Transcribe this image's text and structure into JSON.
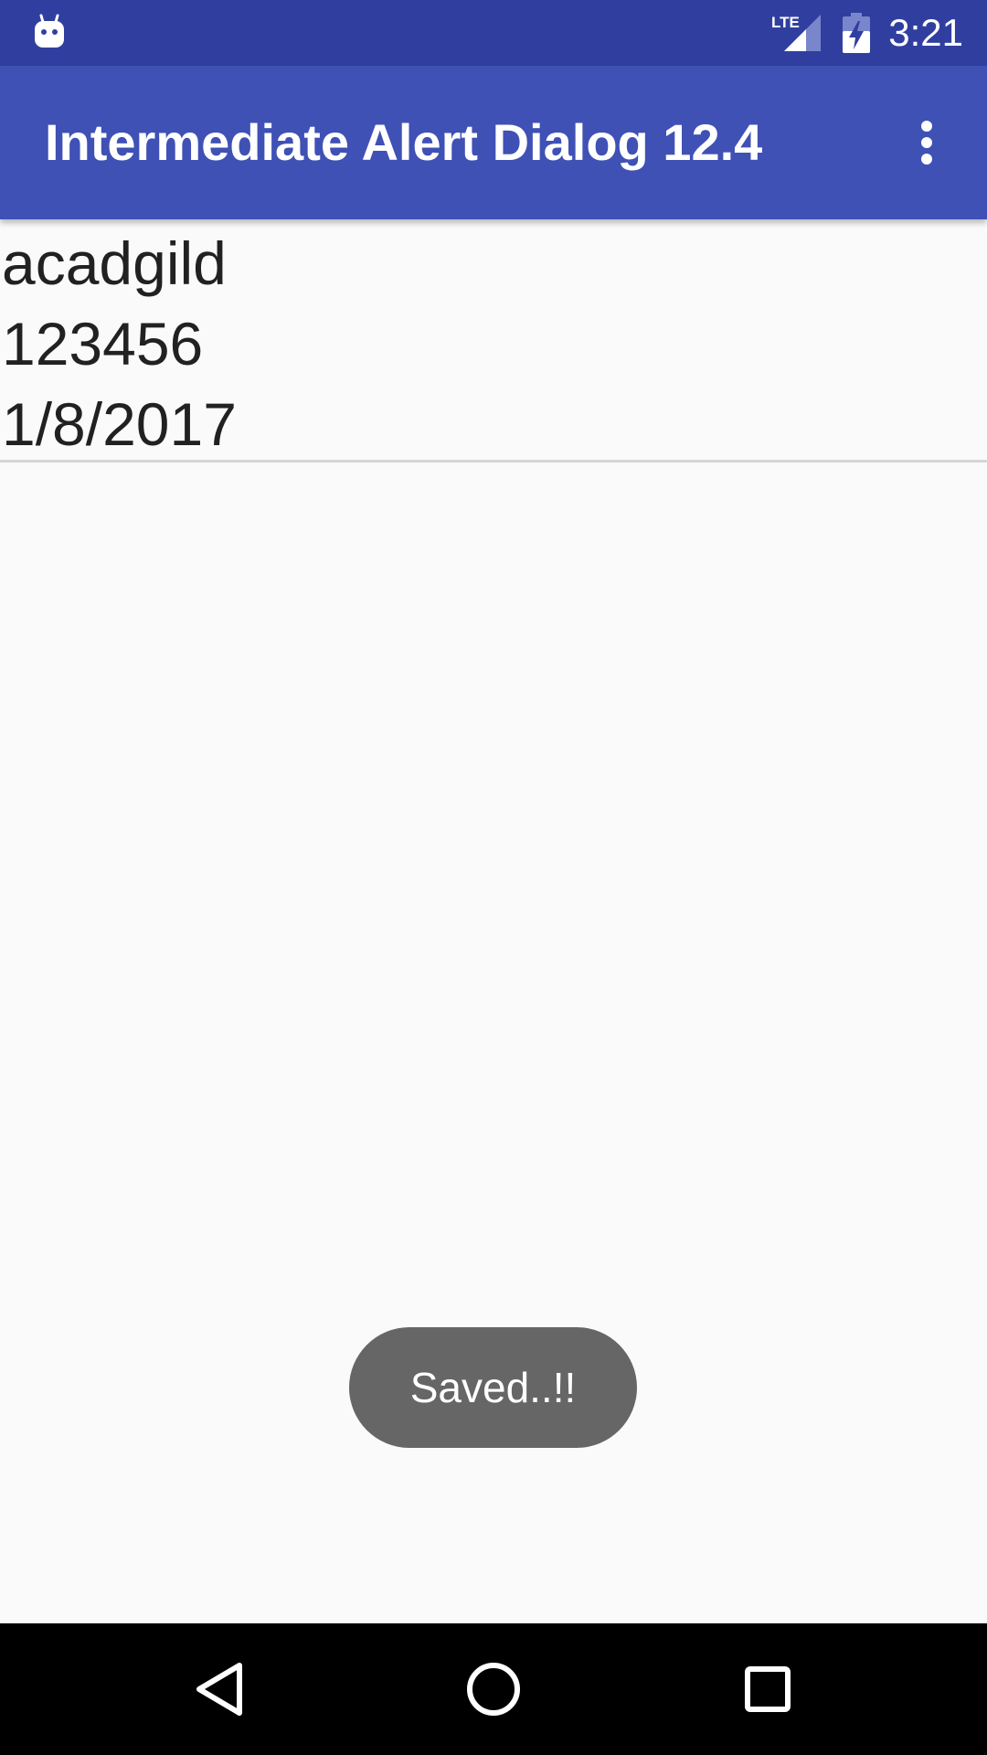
{
  "status_bar": {
    "time": "3:21",
    "network_label": "LTE",
    "icons": [
      "android-icon",
      "lte-signal-icon",
      "battery-charging-icon"
    ]
  },
  "app_bar": {
    "title": "Intermediate Alert Dialog 12.4",
    "menu_icon": "overflow-menu-icon"
  },
  "content": {
    "lines": [
      "acadgild",
      "123456",
      "1/8/2017"
    ]
  },
  "toast": {
    "message": "Saved..!!"
  },
  "nav_bar": {
    "icons": [
      "back-icon",
      "home-icon",
      "recents-icon"
    ]
  },
  "colors": {
    "status_bar": "#303f9f",
    "app_bar": "#3f51b5",
    "background": "#fafafa",
    "toast": "#666666",
    "nav_bar": "#000000"
  }
}
